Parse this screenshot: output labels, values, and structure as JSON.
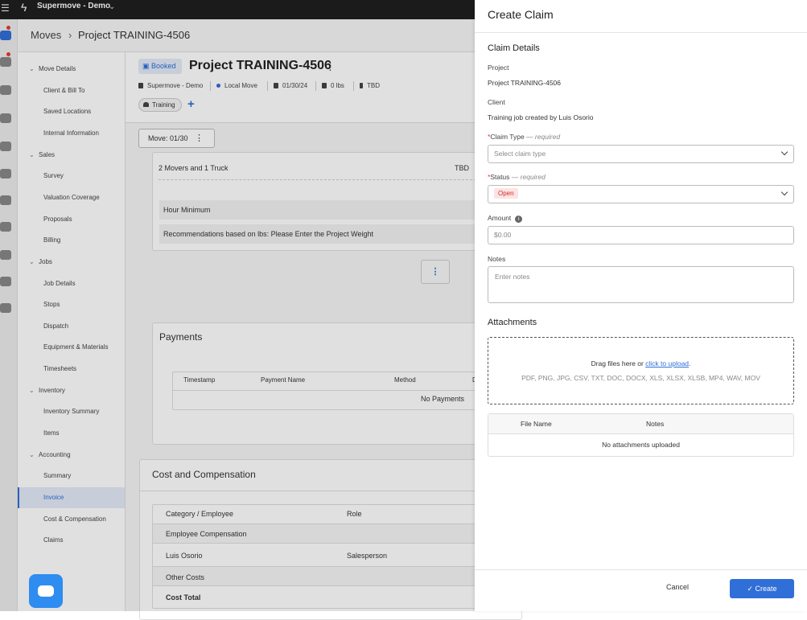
{
  "topbar": {
    "org": "Supermove - Demo"
  },
  "breadcrumb": {
    "root": "Moves",
    "sep": "›",
    "current": "Project TRAINING-4506"
  },
  "sidenav": {
    "move_details": "Move Details",
    "client_bill_to": "Client & Bill To",
    "saved_locations": "Saved Locations",
    "internal_information": "Internal Information",
    "sales": "Sales",
    "survey": "Survey",
    "valuation_coverage": "Valuation Coverage",
    "proposals": "Proposals",
    "billing": "Billing",
    "jobs": "Jobs",
    "job_details": "Job Details",
    "stops": "Stops",
    "dispatch": "Dispatch",
    "equipment_materials": "Equipment & Materials",
    "timesheets": "Timesheets",
    "inventory": "Inventory",
    "inventory_summary": "Inventory Summary",
    "items": "Items",
    "accounting": "Accounting",
    "summary": "Summary",
    "invoice": "Invoice",
    "cost_compensation": "Cost & Compensation",
    "claims": "Claims"
  },
  "project": {
    "status": "Booked",
    "title": "Project TRAINING-4506",
    "org": "Supermove - Demo",
    "move_type": "Local Move",
    "date": "01/30/24",
    "weight": "0 lbs",
    "location": "TBD",
    "tag": "Training",
    "move_button": "Move: 01/30"
  },
  "content": {
    "crew": "2 Movers and 1 Truck",
    "crew_value": "TBD",
    "hour_minimum": "Hour Minimum",
    "recommendations": "Recommendations based on lbs: Please Enter the Project Weight",
    "payments_title": "Payments",
    "payments_headers": [
      "Timestamp",
      "Payment Name",
      "Method",
      "D"
    ],
    "no_payments": "No Payments",
    "cost_title": "Cost and Compensation",
    "cost_headers": [
      "Category / Employee",
      "Role"
    ],
    "employee_comp": "Employee Compensation",
    "employee_name": "Luis Osorio",
    "employee_role": "Salesperson",
    "other_costs": "Other Costs",
    "cost_total": "Cost Total"
  },
  "claim": {
    "title": "Create Claim",
    "details_heading": "Claim Details",
    "project_label": "Project",
    "project_value": "Project TRAINING-4506",
    "client_label": "Client",
    "client_value": "Training job created by Luis Osorio",
    "claim_type_label": "Claim Type",
    "required_text": "— required",
    "claim_type_placeholder": "Select claim type",
    "status_label": "Status",
    "status_value": "Open",
    "amount_label": "Amount",
    "amount_placeholder": "$0.00",
    "notes_label": "Notes",
    "notes_placeholder": "Enter notes",
    "attachments_heading": "Attachments",
    "drop_text": "Drag files here or",
    "upload_link": "click to upload",
    "drop_period": ".",
    "file_types": "PDF, PNG, JPG, CSV, TXT, DOC, DOCX, XLS, XLSX, XLSB, MP4, WAV, MOV",
    "file_name_header": "File Name",
    "notes_header": "Notes",
    "no_attachments": "No attachments uploaded",
    "cancel": "Cancel",
    "create": "Create"
  },
  "colors": {
    "accent": "#2f6fd7",
    "danger": "#d32f2f",
    "topbar": "#1f1f1f"
  }
}
